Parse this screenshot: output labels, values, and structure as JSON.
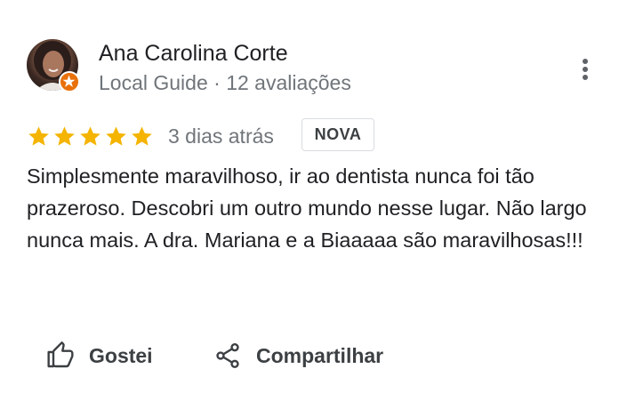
{
  "reviewer": {
    "name": "Ana Carolina Corte",
    "meta": "Local Guide · 12 avaliações",
    "avatar": "reviewer-photo",
    "badge_icon": "local-guide-badge-icon",
    "badge_color": "#e8710a"
  },
  "review": {
    "rating": 5,
    "rating_max": 5,
    "star_color": "#f4b400",
    "date": "3 dias atrás",
    "badge": "NOVA",
    "text": "Simplesmente maravilhoso, ir ao dentista nunca foi tão prazeroso. Descobri um outro mundo nesse lugar. Não largo nunca mais. A dra. Mariana e a Biaaaaa são maravilhosas!!!"
  },
  "actions": {
    "like_label": "Gostei",
    "like_icon": "thumbs-up-icon",
    "share_label": "Compartilhar",
    "share_icon": "share-icon",
    "more_icon": "more-vertical-icon"
  },
  "colors": {
    "text_primary": "#202124",
    "text_secondary": "#70757a",
    "action_text": "#3c4043"
  }
}
